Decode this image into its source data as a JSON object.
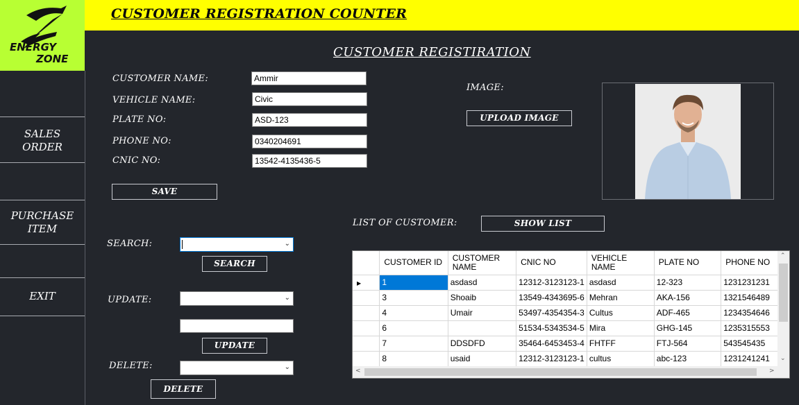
{
  "app": {
    "header_title": "CUSTOMER REGISTRATION COUNTER",
    "logo_line1": "ENERGY",
    "logo_line2": "ZONE",
    "colors": {
      "header": "#ffff00",
      "logo_bg": "#b8ff33",
      "background": "#23262c",
      "selection": "#0078d7"
    }
  },
  "sidebar": {
    "sales_order": "SALES\nORDER",
    "purchase_item": "PURCHASE\nITEM",
    "exit": "EXIT"
  },
  "form": {
    "title": "CUSTOMER REGISTIRATION",
    "customer_name_label": "CUSTOMER NAME:",
    "customer_name_value": "Ammir",
    "vehicle_name_label": "VEHICLE NAME:",
    "vehicle_name_value": "Civic",
    "plate_no_label": "PLATE NO:",
    "plate_no_value": "ASD-123",
    "phone_no_label": "PHONE NO:",
    "phone_no_value": "0340204691",
    "cnic_no_label": "CNIC NO:",
    "cnic_no_value": "13542-4135436-5",
    "save_label": "SAVE",
    "image_label": "IMAGE:",
    "upload_label": "UPLOAD IMAGE"
  },
  "actions": {
    "search_label": "SEARCH:",
    "search_button": "SEARCH",
    "update_label": "UPDATE:",
    "update_button": "UPDATE",
    "delete_label": "DELETE:",
    "delete_button": "DELETE"
  },
  "customer_list": {
    "label": "LIST OF CUSTOMER:",
    "show_button": "SHOW LIST",
    "columns": [
      "CUSTOMER ID",
      "CUSTOMER NAME",
      "CNIC NO",
      "VEHICLE NAME",
      "PLATE NO",
      "PHONE NO"
    ],
    "rows": [
      [
        "1",
        "asdasd",
        "12312-3123123-1",
        "asdasd",
        " 12-323",
        "1231231231"
      ],
      [
        "3",
        "Shoaib",
        "13549-4343695-6",
        "Mehran",
        "AKA-156",
        "1321546489"
      ],
      [
        "4",
        "Umair",
        "53497-4354354-3",
        "Cultus",
        "ADF-465",
        "1234354646"
      ],
      [
        "6",
        "",
        "51534-5343534-5",
        "Mira",
        "GHG-145",
        "1235315553"
      ],
      [
        "7",
        "DDSDFD",
        "35464-6453453-4",
        "FHTFF",
        "FTJ-564",
        "543545435"
      ],
      [
        "8",
        "usaid",
        "12312-3123123-1",
        "cultus",
        "abc-123",
        "1231241241"
      ]
    ],
    "selected_row": 0
  }
}
